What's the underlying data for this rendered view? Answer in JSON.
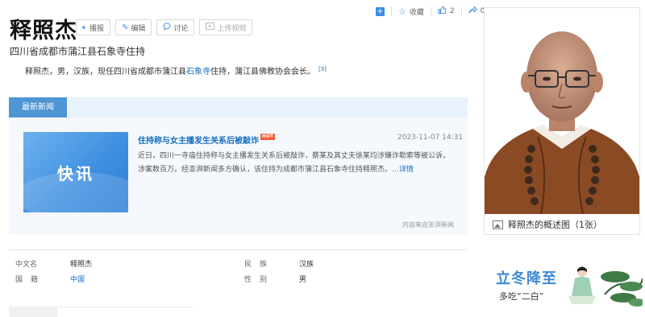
{
  "toolbar": {
    "collect_label": "收藏",
    "like_count": "2",
    "share_count": "0"
  },
  "entry": {
    "title": "释照杰",
    "subtitle": "四川省成都市蒲江县石象寺住持",
    "summary_before": "释照杰，男，汉族，现任四川省成都市蒲江县",
    "summary_link": "石象寺",
    "summary_after": "住持，蒲江县佛教协会会长。",
    "summary_ref": "[3]"
  },
  "actions": {
    "report": "播报",
    "edit": "编辑",
    "discuss": "讨论",
    "upload_video": "上传视频"
  },
  "news": {
    "tab_label": "最新新闻",
    "thumb_text": "快讯",
    "headline": "住持称与女主播发生关系后被敲诈",
    "hot_badge": "HOT",
    "date": "2023-11-07 14:31",
    "text_line1": "近日，四川一寺庙住持称与女主播发生关系后被敲诈，蔡某及其丈夫徐某均涉嫌诈勒索等被公诉，",
    "text_line2": "涉案数百万。经澎湃新闻多方确认，该住持为成都市蒲江县石象寺住持释照杰。",
    "more": "…详情",
    "source": "内容来自澎湃新闻"
  },
  "basic_info": {
    "row1": {
      "label_a": "中文名",
      "value_a": "释照杰",
      "label_b": "民族",
      "value_b": "汉族"
    },
    "row2": {
      "label_a": "国籍",
      "value_a": "中国",
      "label_b": "性别",
      "value_b": "男"
    }
  },
  "portrait": {
    "caption": "释照杰的概述图（1张）"
  },
  "ad": {
    "title": "立冬降至",
    "subtitle": "多吃“二白”"
  },
  "colors": {
    "accent": "#136ec2",
    "tab_blue": "#4e95d5",
    "news_bg": "#f5f8fc"
  }
}
